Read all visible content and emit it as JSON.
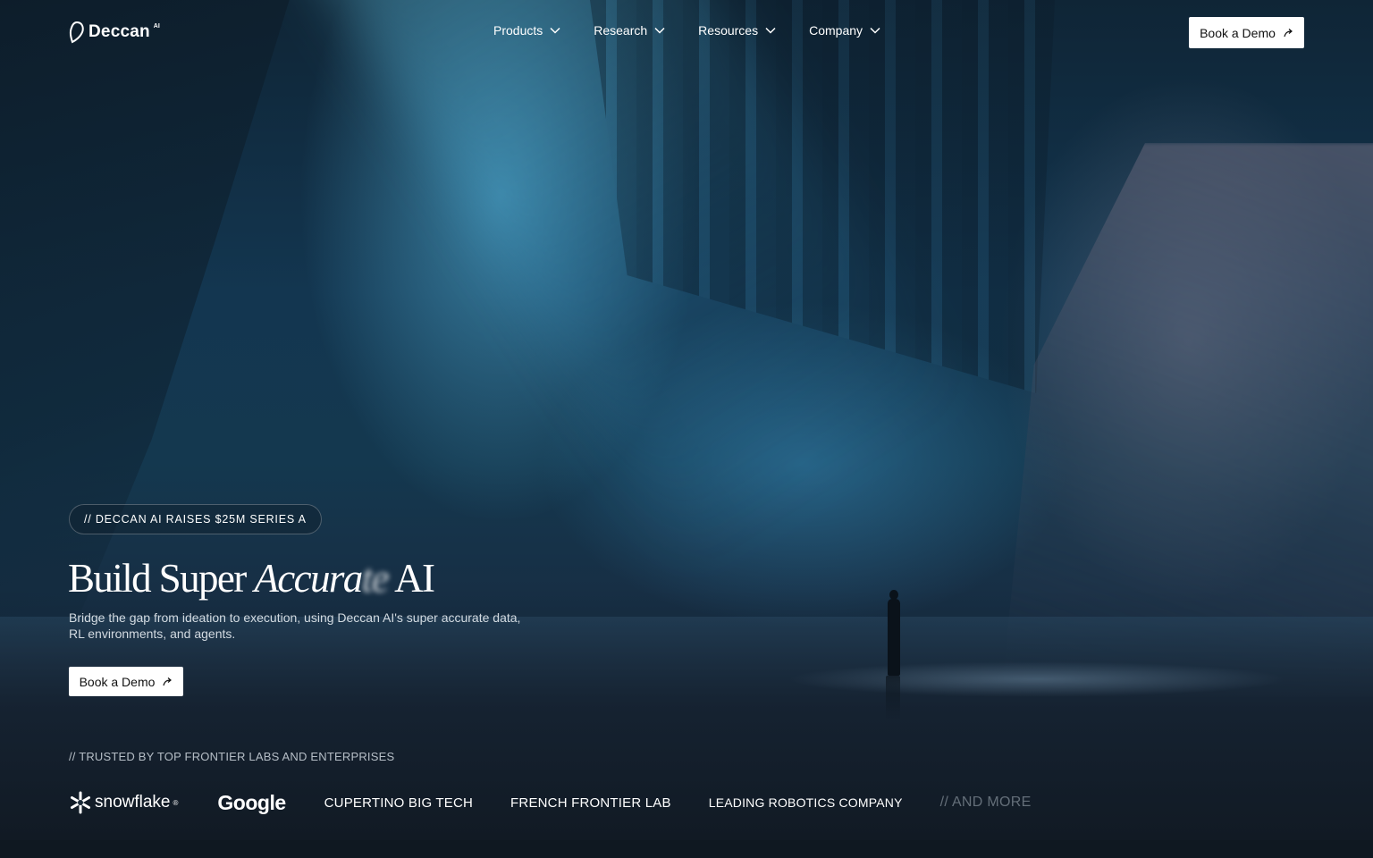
{
  "brand": {
    "name": "Deccan",
    "superscript": "AI"
  },
  "nav": {
    "items": [
      {
        "label": "Products"
      },
      {
        "label": "Research"
      },
      {
        "label": "Resources"
      },
      {
        "label": "Company"
      }
    ],
    "cta_label": "Book a Demo"
  },
  "hero": {
    "announcement": "// DECCAN AI RAISES $25M SERIES A",
    "headline_part1": "Build Super ",
    "headline_italic": "Accura",
    "headline_blur": "te",
    "headline_part2": " AI",
    "subtitle": "Bridge the gap from ideation to execution, using Deccan AI's super accurate data, RL environments, and agents.",
    "cta_label": "Book a Demo"
  },
  "trusted": {
    "label": "// TRUSTED BY TOP FRONTIER LABS AND ENTERPRISES",
    "logos": {
      "snowflake": "snowflake",
      "snowflake_mark": "®",
      "google": "Google",
      "cupertino": "CUPERTINO BIG TECH",
      "french": "FRENCH FRONTIER LAB",
      "robotics": "LEADING ROBOTICS COMPANY",
      "more": "// AND MORE"
    }
  },
  "colors": {
    "accent_button_bg": "#ffffff",
    "accent_button_text": "#111111",
    "background_dark": "#0f1821"
  },
  "icons": [
    "deccan-logo-icon",
    "chevron-down-icon",
    "arrow-up-right-icon",
    "snowflake-icon"
  ]
}
